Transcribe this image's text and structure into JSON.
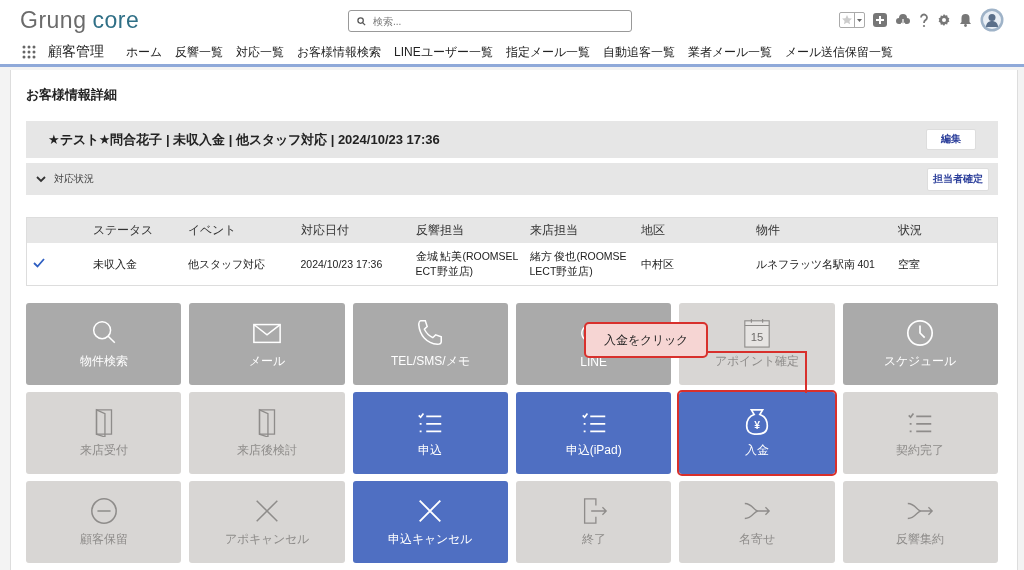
{
  "header": {
    "logo": {
      "part_1": "Grung",
      "part_2": "core"
    },
    "search": {
      "placeholder": "検索..."
    }
  },
  "nav": {
    "app_name": "顧客管理",
    "items": [
      "ホーム",
      "反響一覧",
      "対応一覧",
      "お客様情報検索",
      "LINEユーザー一覧",
      "指定メール一覧",
      "自動追客一覧",
      "業者メール一覧",
      "メール送信保留一覧"
    ]
  },
  "page_title": "お客様情報詳細",
  "record": {
    "title": "★テスト★問合花子 | 未収入金 | 他スタッフ対応 | 2024/10/23 17:36",
    "edit_button": "編集"
  },
  "section": {
    "label": "対応状況",
    "expanded": true,
    "button": "担当者確定"
  },
  "table": {
    "columns": [
      "ステータス",
      "イベント",
      "対応日付",
      "反響担当",
      "来店担当",
      "地区",
      "物件",
      "状況"
    ],
    "rows": [
      {
        "checked": true,
        "cells": [
          "未収入金",
          "他スタッフ対応",
          "2024/10/23 17:36",
          "金城 鮎美(ROOMSELECT野並店)",
          "緒方 俊也(ROOMSELECT野並店)",
          "中村区",
          "ルネフラッツ名駅南 401",
          "空室"
        ]
      }
    ]
  },
  "tiles": [
    {
      "label": "物件検索",
      "kind": "active",
      "highlighted": false
    },
    {
      "label": "メール",
      "kind": "active",
      "highlighted": false
    },
    {
      "label": "TEL/SMS/メモ",
      "kind": "active",
      "highlighted": false
    },
    {
      "label": "LINE",
      "kind": "active",
      "highlighted": false
    },
    {
      "label": "アポイント確定",
      "kind": "disabled",
      "highlighted": false,
      "icon_text": "15"
    },
    {
      "label": "スケジュール",
      "kind": "active",
      "highlighted": false
    },
    {
      "label": "来店受付",
      "kind": "disabled",
      "highlighted": false
    },
    {
      "label": "来店後検討",
      "kind": "disabled",
      "highlighted": false
    },
    {
      "label": "申込",
      "kind": "primary",
      "highlighted": false
    },
    {
      "label": "申込(iPad)",
      "kind": "primary",
      "highlighted": false
    },
    {
      "label": "入金",
      "kind": "primary",
      "highlighted": true,
      "icon_text": "¥"
    },
    {
      "label": "契約完了",
      "kind": "disabled",
      "highlighted": false
    },
    {
      "label": "顧客保留",
      "kind": "disabled",
      "highlighted": false
    },
    {
      "label": "アポキャンセル",
      "kind": "disabled",
      "highlighted": false
    },
    {
      "label": "申込キャンセル",
      "kind": "primary",
      "highlighted": false
    },
    {
      "label": "終了",
      "kind": "disabled",
      "highlighted": false
    },
    {
      "label": "名寄せ",
      "kind": "disabled",
      "highlighted": false
    },
    {
      "label": "反響集約",
      "kind": "disabled",
      "highlighted": false
    }
  ],
  "callout": {
    "text": "入金をクリック"
  }
}
